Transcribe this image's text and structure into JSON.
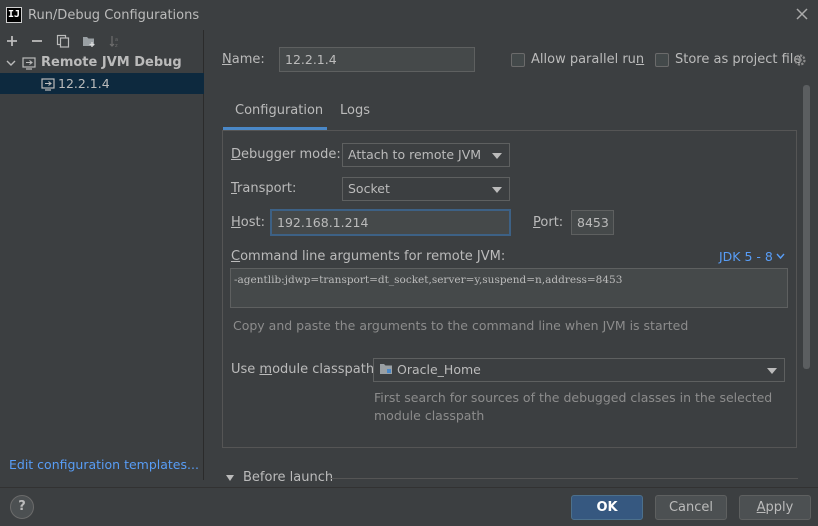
{
  "window": {
    "title": "Run/Debug Configurations",
    "app_icon_text": "IJ"
  },
  "left": {
    "toolbar_icons": [
      "add-icon",
      "remove-icon",
      "copy-icon",
      "folder-add-icon",
      "sort-icon"
    ],
    "group_label": "Remote JVM Debug",
    "item_label": "12.2.1.4",
    "edit_templates": "Edit configuration templates..."
  },
  "header": {
    "name_label_u": "N",
    "name_label_rest": "ame:",
    "name_value": "12.2.1.4",
    "allow_parallel_pre": "Allow parallel ru",
    "allow_parallel_u": "n",
    "store_project_pre": "Store as project file",
    "store_project_u": ""
  },
  "tabs": [
    {
      "label": "Configuration",
      "active": true
    },
    {
      "label": "Logs",
      "active": false
    }
  ],
  "config": {
    "debugger_mode_u": "D",
    "debugger_mode_rest": "ebugger mode:",
    "debugger_mode_value": "Attach to remote JVM",
    "transport_u": "T",
    "transport_rest": "ransport:",
    "transport_value": "Socket",
    "host_u": "H",
    "host_rest": "ost:",
    "host_value": "192.168.1.214",
    "port_u": "P",
    "port_rest": "ort:",
    "port_value": "8453",
    "cmd_label_u": "C",
    "cmd_label_rest": "ommand line arguments for remote JVM:",
    "jdk_link": "JDK 5 - 8",
    "cmd_args": "-agentlib:jdwp=transport=dt_socket,server=y,suspend=n,address=8453",
    "cmd_hint": "Copy and paste the arguments to the command line when JVM is started",
    "module_label_pre": "Use ",
    "module_label_u": "m",
    "module_label_rest": "odule classpath:",
    "module_value": "Oracle_Home",
    "module_hint_1": "First search for sources of the debugged classes in the selected",
    "module_hint_2": "module classpath"
  },
  "before_launch": "Before launch",
  "buttons": {
    "ok": "OK",
    "cancel": "Cancel",
    "apply_u": "A",
    "apply_rest": "pply",
    "help": "?"
  },
  "colors": {
    "accent": "#4a88c7",
    "link": "#589df6",
    "selection": "#0d293e",
    "primary_button": "#365880"
  }
}
